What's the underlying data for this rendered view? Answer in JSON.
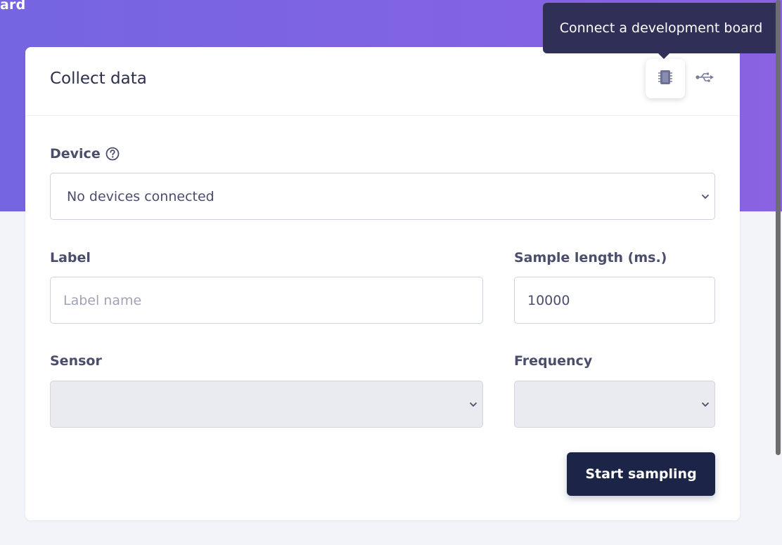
{
  "banner": {
    "title": "ard"
  },
  "card": {
    "title": "Collect data",
    "tooltip": "Connect a development board",
    "icons": {
      "board": "chip-icon",
      "usb": "usb-icon"
    }
  },
  "form": {
    "device": {
      "label": "Device",
      "value": "No devices connected"
    },
    "label": {
      "label": "Label",
      "placeholder": "Label name",
      "value": ""
    },
    "sample_length": {
      "label": "Sample length (ms.)",
      "value": "10000"
    },
    "sensor": {
      "label": "Sensor",
      "value": ""
    },
    "frequency": {
      "label": "Frequency",
      "value": ""
    },
    "start_button": "Start sampling"
  },
  "colors": {
    "banner_start": "#7565e0",
    "banner_end": "#8a62e2",
    "primary_button": "#1c2547",
    "tooltip_bg": "#2f2f57"
  }
}
